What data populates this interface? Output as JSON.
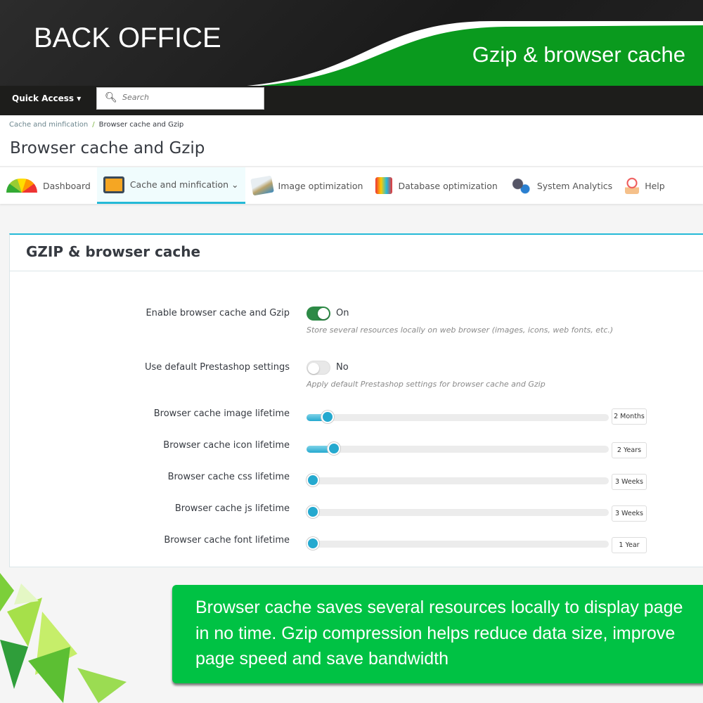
{
  "hero": {
    "title": "BACK OFFICE",
    "subtitle": "Gzip & browser cache"
  },
  "topbar": {
    "quick_access": "Quick Access ▾",
    "search_placeholder": "Search"
  },
  "breadcrumb": {
    "parent": "Cache and minfication",
    "separator": "/",
    "current": "Browser cache and Gzip"
  },
  "page_title": "Browser cache and Gzip",
  "tabs": [
    {
      "label": "Dashboard",
      "icon": "gauge-icon"
    },
    {
      "label": "Cache and minfication ⌄",
      "icon": "html-monitor-icon",
      "active": true
    },
    {
      "label": "Image optimization",
      "icon": "image-icon"
    },
    {
      "label": "Database optimization",
      "icon": "database-icon"
    },
    {
      "label": "System Analytics",
      "icon": "gears-icon"
    },
    {
      "label": "Help",
      "icon": "help-icon"
    }
  ],
  "panel": {
    "title": "GZIP & browser cache",
    "enable": {
      "label": "Enable browser cache and Gzip",
      "state": "On",
      "help": "Store several resources locally on web browser (images, icons, web fonts, etc.)"
    },
    "default": {
      "label": "Use default Prestashop settings",
      "state": "No",
      "help": "Apply default Prestashop settings for browser cache and Gzip"
    },
    "sliders": [
      {
        "label": "Browser cache image lifetime",
        "value": "2 Months",
        "fraction": 0.07
      },
      {
        "label": "Browser cache icon lifetime",
        "value": "2 Years",
        "fraction": 0.09
      },
      {
        "label": "Browser cache css lifetime",
        "value": "3 Weeks",
        "fraction": 0.0
      },
      {
        "label": "Browser cache js lifetime",
        "value": "3 Weeks",
        "fraction": 0.0
      },
      {
        "label": "Browser cache font lifetime",
        "value": "1 Year",
        "fraction": 0.0
      }
    ]
  },
  "callout": "Browser cache saves several resources locally to display page in no time. Gzip compression helps reduce data size, improve page speed and save bandwidth",
  "colors": {
    "accent": "#25b9d7",
    "toggle_on": "#2d8a46",
    "brand_green": "#00c244"
  }
}
